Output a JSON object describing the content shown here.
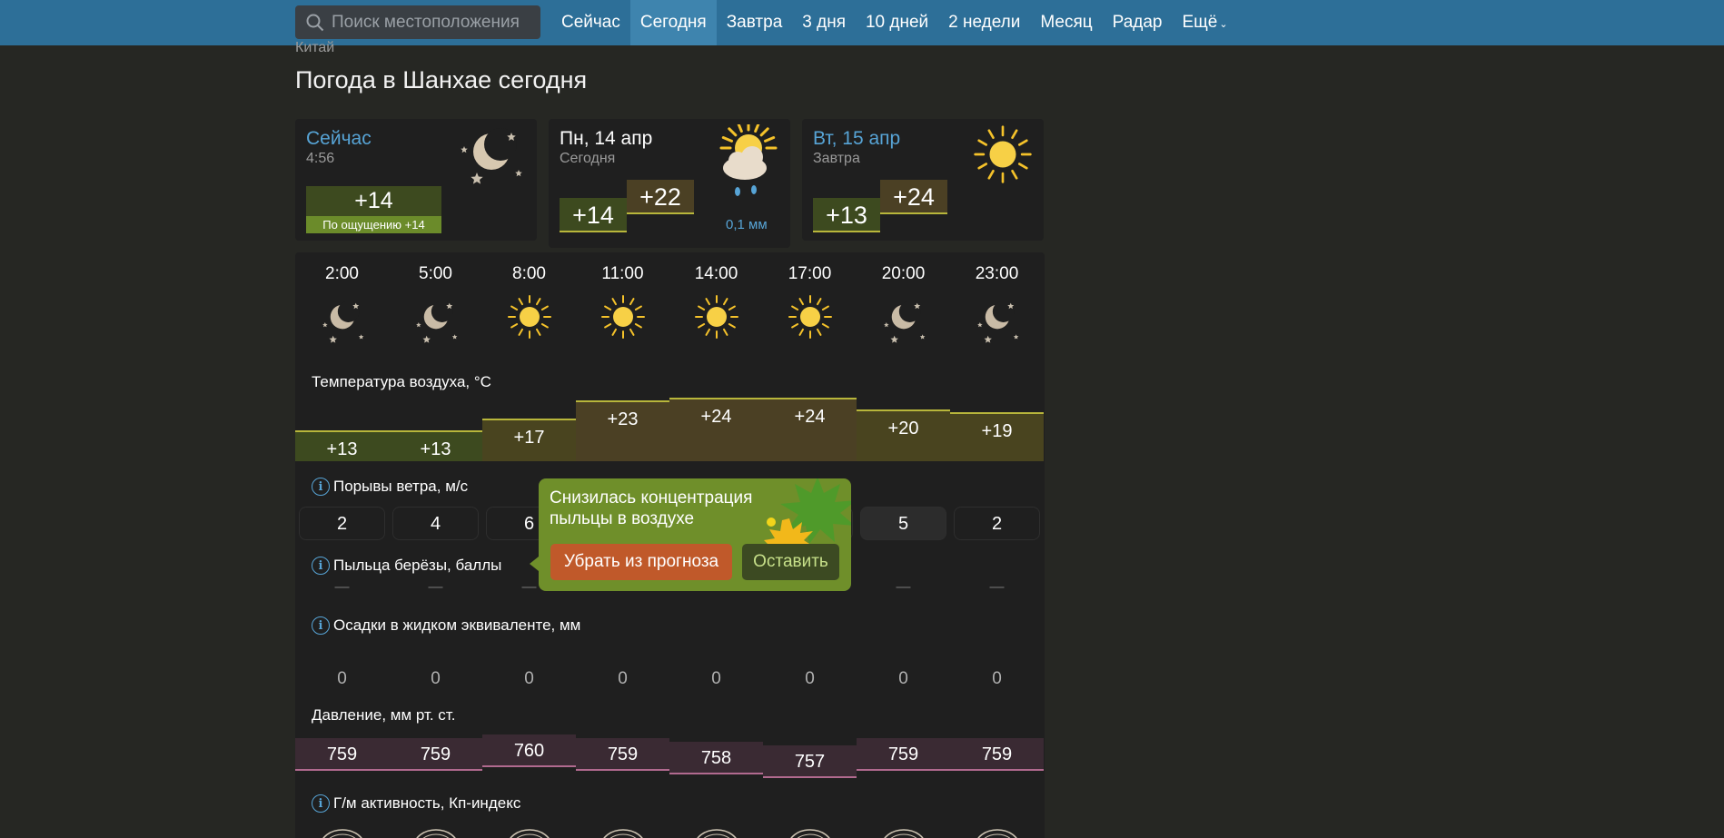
{
  "search": {
    "placeholder": "Поиск местоположения"
  },
  "nav": [
    "Сейчас",
    "Сегодня",
    "Завтра",
    "3 дня",
    "10 дней",
    "2 недели",
    "Месяц",
    "Радар",
    "Ещё"
  ],
  "nav_active": "Сегодня",
  "breadcrumb": "Китай",
  "page_title": "Погода в Шанхае сегодня",
  "cards": {
    "now": {
      "title": "Сейчас",
      "time": "4:56",
      "temp": "+14",
      "feels": "По ощущению +14",
      "icon": "night-moon-stars-icon"
    },
    "today": {
      "title": "Пн, 14 апр",
      "sub": "Сегодня",
      "min": "+14",
      "max": "+22",
      "precip": "0,1 мм",
      "icon": "partly-cloudy-rain-icon"
    },
    "tomorrow": {
      "title": "Вт, 15 апр",
      "sub": "Завтра",
      "min": "+13",
      "max": "+24",
      "icon": "sun-icon"
    }
  },
  "hours": [
    "2:00",
    "5:00",
    "8:00",
    "11:00",
    "14:00",
    "17:00",
    "20:00",
    "23:00"
  ],
  "hour_icons": [
    "night",
    "night",
    "sun",
    "sun",
    "sun",
    "sun",
    "night",
    "night"
  ],
  "labels": {
    "temp": "Температура воздуха, °C",
    "wind": "Порывы ветра, м/с",
    "pollen": "Пыльца берёзы, баллы",
    "precip": "Осадки в жидком эквиваленте, мм",
    "pressure": "Давление, мм рт. ст.",
    "geo": "Г/м активность, Кп-индекс"
  },
  "temps": [
    "+13",
    "+13",
    "+17",
    "+23",
    "+24",
    "+24",
    "+20",
    "+19"
  ],
  "temp_values": [
    13,
    13,
    17,
    23,
    24,
    24,
    20,
    19
  ],
  "wind": [
    "2",
    "4",
    "6",
    "",
    "",
    "",
    "5",
    "2"
  ],
  "pollen": [
    "—",
    "—",
    "—",
    "—",
    "—",
    "—",
    "—",
    "—"
  ],
  "precip": [
    "0",
    "0",
    "0",
    "0",
    "0",
    "0",
    "0",
    "0"
  ],
  "pressure": [
    "759",
    "759",
    "760",
    "759",
    "758",
    "757",
    "759",
    "759"
  ],
  "pressure_values": [
    759,
    759,
    760,
    759,
    758,
    757,
    759,
    759
  ],
  "popup": {
    "message": "Снизилась концентрация пыльцы в воздухе",
    "remove": "Убрать из прогноза",
    "keep": "Оставить"
  }
}
